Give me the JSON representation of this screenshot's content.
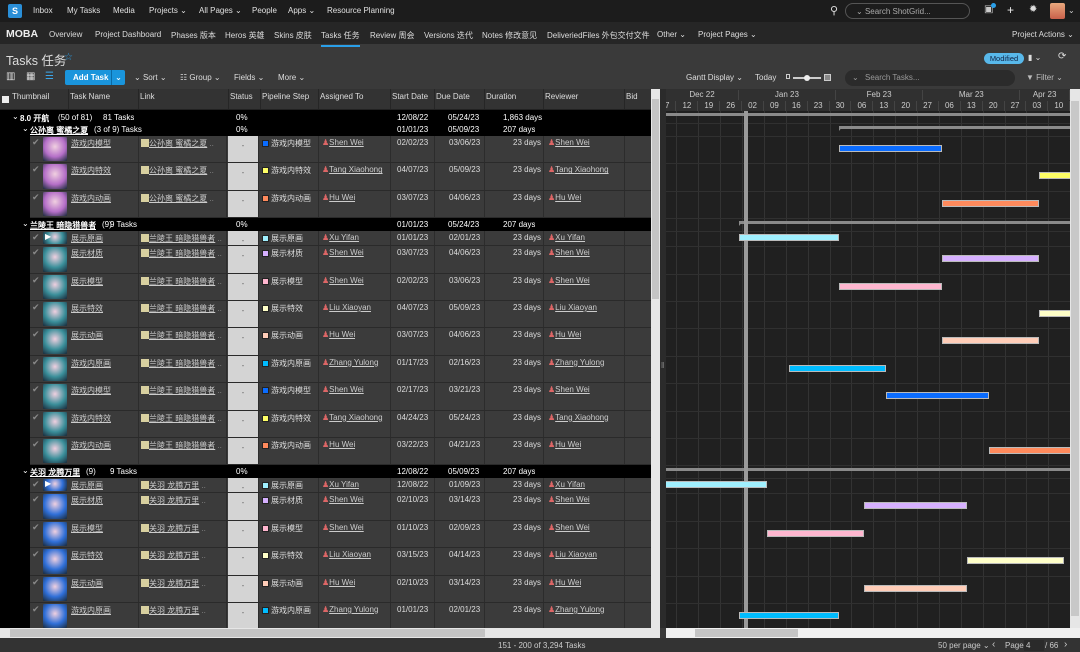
{
  "topnav": {
    "logo": "S",
    "items": [
      "Inbox",
      "My Tasks",
      "Media",
      "Projects ⌄",
      "All Pages ⌄",
      "People",
      "Apps ⌄",
      "Resource Planning"
    ],
    "search_placeholder": "Search ShotGrid..."
  },
  "projectnav": {
    "project": "MOBA",
    "items": [
      "Overview",
      "Project Dashboard",
      "Phases 版本",
      "Heros 英雄",
      "Skins 皮肤",
      "Tasks 任务",
      "Review 周会",
      "Versions 迭代",
      "Notes 修改意见",
      "DeliveriedFiles 外包交付文件",
      "Other ⌄",
      "Project Pages ⌄"
    ],
    "active": 5,
    "actions": "Project Actions ⌄"
  },
  "page": {
    "title": "Tasks 任务",
    "modified": "Modified"
  },
  "toolbar": {
    "add_task": "Add Task",
    "sort": "Sort ⌄",
    "group": "Group ⌄",
    "fields": "Fields ⌄",
    "more": "More ⌄",
    "gantt_display": "Gantt Display ⌄",
    "today": "Today",
    "search_placeholder": "Search Tasks...",
    "filter": "Filter ⌄"
  },
  "columns": [
    "Thumbnail",
    "Task Name",
    "Link",
    "Status",
    "Pipeline Step",
    "Assigned To",
    "Start Date",
    "Due Date",
    "Duration",
    "Reviewer",
    "Bid"
  ],
  "colors": {
    "游戏内模型": "#0a6cff",
    "游戏内特效": "#ffff66",
    "游戏内动画": "#ff8a5c",
    "展示原画": "#a0f0ff",
    "展示材质": "#d6b0ff",
    "展示模型": "#ffb6cf",
    "展示特效": "#ffffc8",
    "展示动画": "#ffcdb8",
    "游戏内原画": "#00bcff"
  },
  "groups": [
    {
      "level": 0,
      "name": "8.0 开航",
      "count": "(50 of 81)",
      "tasks_label": "81 Tasks",
      "pct": "0%",
      "start": "12/08/22",
      "due": "05/24/23",
      "duration": "1,863 days"
    },
    {
      "level": 1,
      "name": "公孙离 蜜橘之夏",
      "count": "(3 of 9) Tasks",
      "tasks_label": "",
      "pct": "0%",
      "start": "01/01/23",
      "due": "05/09/23",
      "duration": "207 days",
      "thumb": "#b56fc8",
      "tasks": [
        {
          "name": "游戏内模型",
          "link": "公孙离 蜜橘之夏",
          "status": "-",
          "step": "游戏内模型",
          "assigned": "Shen Wei",
          "start": "02/02/23",
          "due": "03/06/23",
          "duration": "23 days",
          "reviewer": "Shen Wei"
        },
        {
          "name": "游戏内特效",
          "link": "公孙离 蜜橘之夏",
          "status": "-",
          "step": "游戏内特效",
          "assigned": "Tang Xiaohong",
          "start": "04/07/23",
          "due": "05/09/23",
          "duration": "23 days",
          "reviewer": "Tang Xiaohong"
        },
        {
          "name": "游戏内动画",
          "link": "公孙离 蜜橘之夏",
          "status": "-",
          "step": "游戏内动画",
          "assigned": "Hu Wei",
          "start": "03/07/23",
          "due": "04/06/23",
          "duration": "23 days",
          "reviewer": "Hu Wei"
        }
      ]
    },
    {
      "level": 1,
      "name": "兰陵王 暗隐猎兽者",
      "count": "(9)",
      "tasks_label": "9 Tasks",
      "pct": "0%",
      "start": "01/01/23",
      "due": "05/24/23",
      "duration": "207 days",
      "thumb": "#3a8f9a",
      "tasks": [
        {
          "name": "展示原画",
          "link": "兰陵王 暗隐猎兽者",
          "status": "-",
          "step": "展示原画",
          "assigned": "Xu Yifan",
          "start": "01/01/23",
          "due": "02/01/23",
          "duration": "23 days",
          "reviewer": "Xu Yifan",
          "short": true
        },
        {
          "name": "展示材质",
          "link": "兰陵王 暗隐猎兽者",
          "status": "-",
          "step": "展示材质",
          "assigned": "Shen Wei",
          "start": "03/07/23",
          "due": "04/06/23",
          "duration": "23 days",
          "reviewer": "Shen Wei"
        },
        {
          "name": "展示模型",
          "link": "兰陵王 暗隐猎兽者",
          "status": "-",
          "step": "展示模型",
          "assigned": "Shen Wei",
          "start": "02/02/23",
          "due": "03/06/23",
          "duration": "23 days",
          "reviewer": "Shen Wei"
        },
        {
          "name": "展示特效",
          "link": "兰陵王 暗隐猎兽者",
          "status": "-",
          "step": "展示特效",
          "assigned": "Liu Xiaoyan",
          "start": "04/07/23",
          "due": "05/09/23",
          "duration": "23 days",
          "reviewer": "Liu Xiaoyan"
        },
        {
          "name": "展示动画",
          "link": "兰陵王 暗隐猎兽者",
          "status": "-",
          "step": "展示动画",
          "assigned": "Hu Wei",
          "start": "03/07/23",
          "due": "04/06/23",
          "duration": "23 days",
          "reviewer": "Hu Wei"
        },
        {
          "name": "游戏内原画",
          "link": "兰陵王 暗隐猎兽者",
          "status": "-",
          "step": "游戏内原画",
          "assigned": "Zhang Yulong",
          "start": "01/17/23",
          "due": "02/16/23",
          "duration": "23 days",
          "reviewer": "Zhang Yulong"
        },
        {
          "name": "游戏内模型",
          "link": "兰陵王 暗隐猎兽者",
          "status": "-",
          "step": "游戏内模型",
          "assigned": "Shen Wei",
          "start": "02/17/23",
          "due": "03/21/23",
          "duration": "23 days",
          "reviewer": "Shen Wei"
        },
        {
          "name": "游戏内特效",
          "link": "兰陵王 暗隐猎兽者",
          "status": "-",
          "step": "游戏内特效",
          "assigned": "Tang Xiaohong",
          "start": "04/24/23",
          "due": "05/24/23",
          "duration": "23 days",
          "reviewer": "Tang Xiaohong"
        },
        {
          "name": "游戏内动画",
          "link": "兰陵王 暗隐猎兽者",
          "status": "-",
          "step": "游戏内动画",
          "assigned": "Hu Wei",
          "start": "03/22/23",
          "due": "04/21/23",
          "duration": "23 days",
          "reviewer": "Hu Wei"
        }
      ]
    },
    {
      "level": 1,
      "name": "关羽 龙腾万里",
      "count": "(9)",
      "tasks_label": "9 Tasks",
      "pct": "0%",
      "start": "12/08/22",
      "due": "05/09/23",
      "duration": "207 days",
      "thumb": "#2f6fd8",
      "tasks": [
        {
          "name": "展示原画",
          "link": "关羽 龙腾万里",
          "status": "-",
          "step": "展示原画",
          "assigned": "Xu Yifan",
          "start": "12/08/22",
          "due": "01/09/23",
          "duration": "23 days",
          "reviewer": "Xu Yifan",
          "short": true
        },
        {
          "name": "展示材质",
          "link": "关羽 龙腾万里",
          "status": "-",
          "step": "展示材质",
          "assigned": "Shen Wei",
          "start": "02/10/23",
          "due": "03/14/23",
          "duration": "23 days",
          "reviewer": "Shen Wei"
        },
        {
          "name": "展示模型",
          "link": "关羽 龙腾万里",
          "status": "-",
          "step": "展示模型",
          "assigned": "Shen Wei",
          "start": "01/10/23",
          "due": "02/09/23",
          "duration": "23 days",
          "reviewer": "Shen Wei"
        },
        {
          "name": "展示特效",
          "link": "关羽 龙腾万里",
          "status": "-",
          "step": "展示特效",
          "assigned": "Liu Xiaoyan",
          "start": "03/15/23",
          "due": "04/14/23",
          "duration": "23 days",
          "reviewer": "Liu Xiaoyan"
        },
        {
          "name": "展示动画",
          "link": "关羽 龙腾万里",
          "status": "-",
          "step": "展示动画",
          "assigned": "Hu Wei",
          "start": "02/10/23",
          "due": "03/14/23",
          "duration": "23 days",
          "reviewer": "Hu Wei"
        },
        {
          "name": "游戏内原画",
          "link": "关羽 龙腾万里",
          "status": "-",
          "step": "游戏内原画",
          "assigned": "Zhang Yulong",
          "start": "01/01/23",
          "due": "02/01/23",
          "duration": "23 days",
          "reviewer": "Zhang Yulong"
        }
      ]
    }
  ],
  "gantt": {
    "months": [
      {
        "label": "Dec 22",
        "start": "12/01/22"
      },
      {
        "label": "Jan 23",
        "start": "01/01/23"
      },
      {
        "label": "Feb 23",
        "start": "02/01/23"
      },
      {
        "label": "Mar 23",
        "start": "03/01/23"
      },
      {
        "label": "Apr 23",
        "start": "04/01/23"
      }
    ],
    "weeks": [
      "07",
      "12",
      "19",
      "26",
      "02",
      "09",
      "16",
      "23",
      "30",
      "06",
      "13",
      "20",
      "27",
      "06",
      "13",
      "20",
      "27",
      "03",
      "10"
    ],
    "today": "01/03/23"
  },
  "footer": {
    "range": "151 - 200 of 3,294 Tasks",
    "per_page": "50 per page ⌄",
    "page_label": "Page",
    "page": "4",
    "total": "/ 66"
  }
}
